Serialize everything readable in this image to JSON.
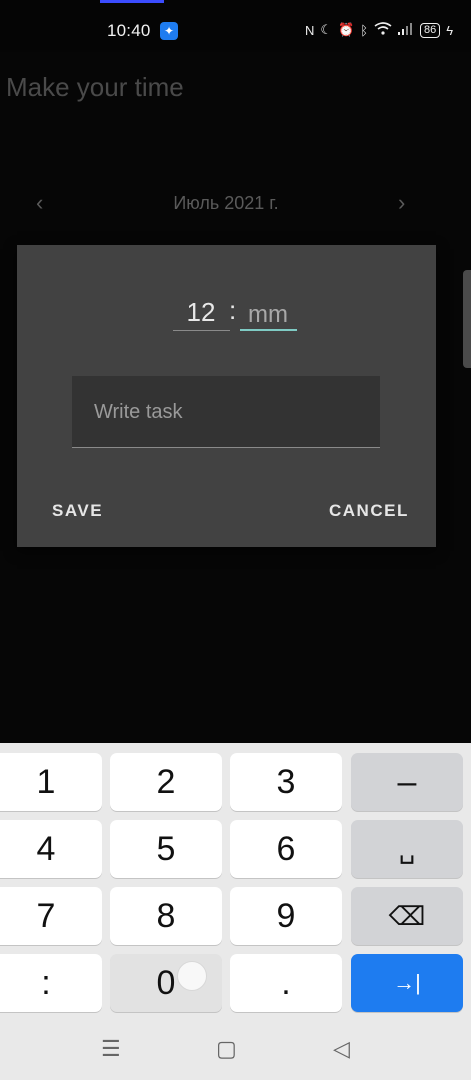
{
  "status_bar": {
    "time": "10:40",
    "notification_icon": "app-notification-icon",
    "icons": [
      "nfc-icon",
      "moon-icon",
      "alarm-icon",
      "bluetooth-icon",
      "wifi-icon",
      "signal-icon"
    ],
    "battery": "86"
  },
  "app": {
    "title": "Make your time"
  },
  "calendar": {
    "month_label": "Июль 2021 г.",
    "prev_symbol": "‹",
    "next_symbol": "›"
  },
  "dialog": {
    "hour_value": "12",
    "time_separator": ":",
    "minute_placeholder": "mm",
    "task_placeholder": "Write task",
    "save_label": "SAVE",
    "cancel_label": "CANCEL",
    "accent_color": "#7fcbc4"
  },
  "keyboard": {
    "keys": {
      "k1": "1",
      "k2": "2",
      "k3": "3",
      "dash": "–",
      "k4": "4",
      "k5": "5",
      "k6": "6",
      "space": "␣",
      "k7": "7",
      "k8": "8",
      "k9": "9",
      "backspace": "⌫",
      "colon": ":",
      "k0": "0",
      "dot": ".",
      "next": "→|"
    },
    "action_color": "#1e7cf0"
  },
  "nav_bar": {
    "menu": "☰",
    "home": "▢",
    "back": "◁"
  }
}
